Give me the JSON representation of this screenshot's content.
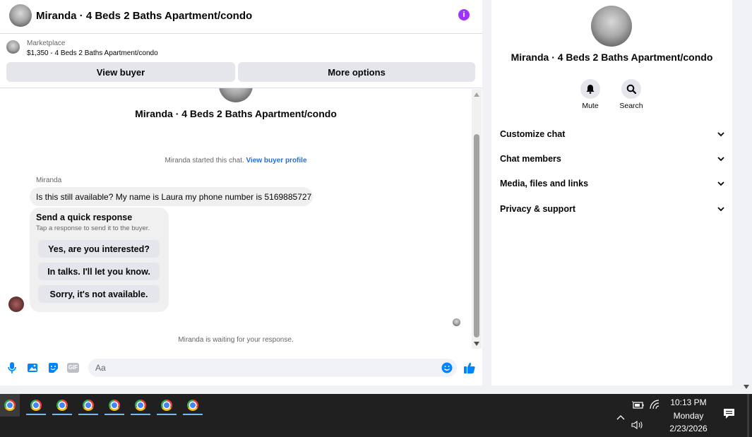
{
  "chat": {
    "title": "Miranda · 4 Beds 2 Baths Apartment/condo",
    "marketplace_label": "Marketplace",
    "listing": "$1,350 - 4 Beds 2 Baths Apartment/condo",
    "view_buyer": "View buyer",
    "more_options": "More options",
    "intro_title": "Miranda · 4 Beds 2 Baths Apartment/condo",
    "started_text": "Miranda started this chat.",
    "view_buyer_profile": "View buyer profile",
    "sender_name": "Miranda",
    "message": "Is this still available? My name is Laura my phone number is 5169885727",
    "quick_title": "Send a quick response",
    "quick_subtitle": "Tap a response to send it to the buyer.",
    "quick_responses": [
      "Yes, are you interested?",
      "In talks. I'll let you know.",
      "Sorry, it's not available."
    ],
    "waiting_text": "Miranda is waiting for your response.",
    "composer_placeholder": "Aa",
    "gif_label": "GIF"
  },
  "info": {
    "title": "Miranda · 4 Beds 2 Baths Apartment/condo",
    "mute": "Mute",
    "search": "Search",
    "rows": [
      "Customize chat",
      "Chat members",
      "Media, files and links",
      "Privacy & support"
    ]
  },
  "taskbar": {
    "time": "10:13 PM",
    "day": "Monday",
    "date": "2/23/2026"
  },
  "colors": {
    "accent": "#0084ff",
    "info_purple": "#a033ff",
    "link": "#216fdb",
    "taskbar": "#202020"
  }
}
